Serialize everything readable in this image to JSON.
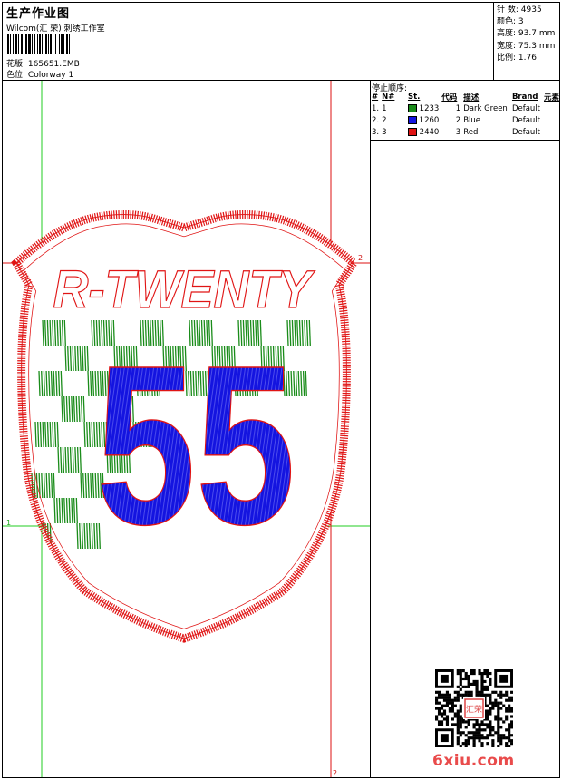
{
  "header": {
    "title": "生产作业图",
    "company": "Wilcom(汇 荣) 刺绣工作室",
    "pattern_label": "花版:",
    "pattern_value": "165651.EMB",
    "colorway_label": "色位:",
    "colorway_value": "Colorway 1"
  },
  "stats": {
    "stitches_label": "针 数:",
    "stitches_value": "4935",
    "colors_label": "颜色:",
    "colors_value": "3",
    "height_label": "高度:",
    "height_value": "93.7 mm",
    "width_label": "宽度:",
    "width_value": "75.3 mm",
    "ratio_label": "比例:",
    "ratio_value": "1.76"
  },
  "stop_sequence": {
    "title": "停止顺序:",
    "headers": [
      "#",
      "N#",
      "St.",
      "代码",
      "描述",
      "Brand",
      "元素"
    ],
    "rows": [
      {
        "index": "1.",
        "n": "1",
        "swatch": "#1a8c1a",
        "stitches": "1233",
        "code": "1",
        "description": "Dark Green",
        "brand": "Default"
      },
      {
        "index": "2.",
        "n": "2",
        "swatch": "#1414e0",
        "stitches": "1260",
        "code": "2",
        "description": "Blue",
        "brand": "Default"
      },
      {
        "index": "3.",
        "n": "3",
        "swatch": "#e01414",
        "stitches": "2440",
        "code": "3",
        "description": "Red",
        "brand": "Default"
      }
    ]
  },
  "design": {
    "wordmark": "R-TWENTY",
    "number": "55",
    "guide_labels": {
      "left": "1",
      "top_right": "2",
      "bottom": "2"
    },
    "colors": {
      "green": "#1a8c1a",
      "blue": "#1414e0",
      "red": "#e01414",
      "guide_green": "#22cc22",
      "guide_red": "#dd1111"
    }
  },
  "watermark": {
    "stamp_text": "汇荣",
    "site": "6xiu.com"
  }
}
